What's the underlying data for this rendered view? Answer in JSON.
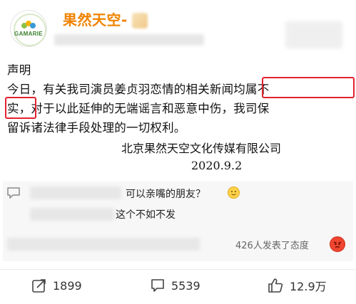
{
  "post": {
    "author": "果然天空-",
    "avatar_text": "GAMARIE",
    "lines": [
      "声明",
      "今日，有关我司演员姜贞羽恋情的相关新闻均属不",
      "实，对于以此延伸的无端谣言和恶意中伤，我司保",
      "留诉诸法律手段处理的一切权利。"
    ],
    "company": "北京果然天空文化传媒有限公司",
    "date": "2020.9.2"
  },
  "comments": [
    {
      "text": "可以亲嘴的朋友？"
    },
    {
      "text": "这个不如不发"
    }
  ],
  "reactions": {
    "summary": "426人发表了态度"
  },
  "actions": {
    "repost_count": "1899",
    "comment_count": "5539",
    "like_count": "12.9万"
  },
  "colors": {
    "author": "#f08300",
    "highlight_box": "#e4222f",
    "text": "#111111"
  },
  "icons": [
    "repost-icon",
    "comment-icon",
    "like-icon",
    "quote-icon",
    "angry-emoji-icon",
    "smile-emoji-icon"
  ]
}
